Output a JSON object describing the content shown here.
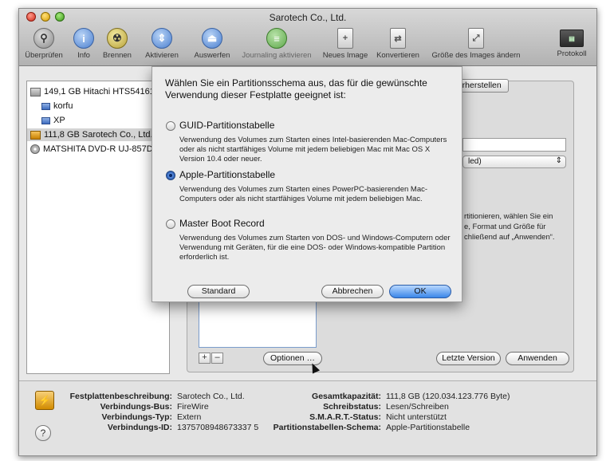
{
  "window": {
    "title": "Sarotech Co., Ltd."
  },
  "toolbar": {
    "items": [
      {
        "label": "Überprüfen",
        "icon": "microscope-icon"
      },
      {
        "label": "Info",
        "icon": "info-icon"
      },
      {
        "label": "Brennen",
        "icon": "burn-icon"
      },
      {
        "label": "Aktivieren",
        "icon": "mount-icon"
      },
      {
        "label": "Auswerfen",
        "icon": "eject-icon"
      },
      {
        "label": "Journaling aktivieren",
        "icon": "journaling-icon"
      },
      {
        "label": "Neues Image",
        "icon": "new-image-icon"
      },
      {
        "label": "Konvertieren",
        "icon": "convert-icon"
      },
      {
        "label": "Größe des Images ändern",
        "icon": "resize-image-icon"
      },
      {
        "label": "Protokoll",
        "icon": "log-icon"
      }
    ]
  },
  "sidebar": {
    "disks": [
      {
        "label": "149,1 GB Hitachi HTS54161",
        "icon": "hard-disk-icon"
      },
      {
        "label": "korfu",
        "icon": "volume-icon"
      },
      {
        "label": "XP",
        "icon": "volume-icon"
      },
      {
        "label": "111,8 GB Sarotech Co., Ltd.",
        "icon": "external-disk-icon"
      },
      {
        "label": "MATSHITA DVD-R UJ-857D",
        "icon": "dvd-drive-icon"
      }
    ]
  },
  "main": {
    "tab_partial": "derherstellen",
    "format_hint": "Mac OS Extended (Journaled)",
    "format_hint_partial": "led)",
    "instructions_lines": [
      "rtitionieren, wählen Sie ein",
      "e, Format und Größe für",
      "chließend auf „Anwenden“."
    ],
    "plus_label": "+",
    "minus_label": "–",
    "options_button": "Optionen …",
    "revert_button": "Letzte Version",
    "apply_button": "Anwenden"
  },
  "dialog": {
    "heading": "Wählen Sie ein Partitionsschema aus, das für die gewünschte Verwendung dieser Festplatte geeignet ist:",
    "options": [
      {
        "label": "GUID-Partitionstabelle",
        "selected": false,
        "description": "Verwendung des Volumes zum Starten eines Intel-basierenden Mac-Computers oder als nicht startfähiges Volume mit jedem beliebigen Mac mit Mac OS X Version 10.4 oder neuer."
      },
      {
        "label": "Apple-Partitionstabelle",
        "selected": true,
        "description": "Verwendung des Volumes zum Starten eines PowerPC-basierenden Mac-Computers oder als nicht startfähiges Volume mit jedem beliebigen Mac."
      },
      {
        "label": "Master Boot Record",
        "selected": false,
        "description": "Verwendung des Volumes zum Starten von DOS- und Windows-Computern oder Verwendung mit Geräten, für die eine DOS- oder Windows-kompatible Partition erforderlich ist."
      }
    ],
    "default_button": "Standard",
    "cancel_button": "Abbrechen",
    "ok_button": "OK"
  },
  "info": {
    "left": [
      {
        "label": "Festplattenbeschreibung:",
        "value": "Sarotech Co., Ltd."
      },
      {
        "label": "Verbindungs-Bus:",
        "value": "FireWire"
      },
      {
        "label": "Verbindungs-Typ:",
        "value": "Extern"
      },
      {
        "label": "Verbindungs-ID:",
        "value": "1375708948673337 5"
      }
    ],
    "right": [
      {
        "label": "Gesamtkapazität:",
        "value": "111,8 GB (120.034.123.776 Byte)"
      },
      {
        "label": "Schreibstatus:",
        "value": "Lesen/Schreiben"
      },
      {
        "label": "S.M.A.R.T.-Status:",
        "value": "Nicht unterstützt"
      },
      {
        "label": "Partitionstabellen-Schema:",
        "value": "Apple-Partitionstabelle"
      }
    ],
    "help_label": "?"
  },
  "colors": {
    "ok_button": "#3a86e8",
    "selection": "#d3d3d3"
  }
}
